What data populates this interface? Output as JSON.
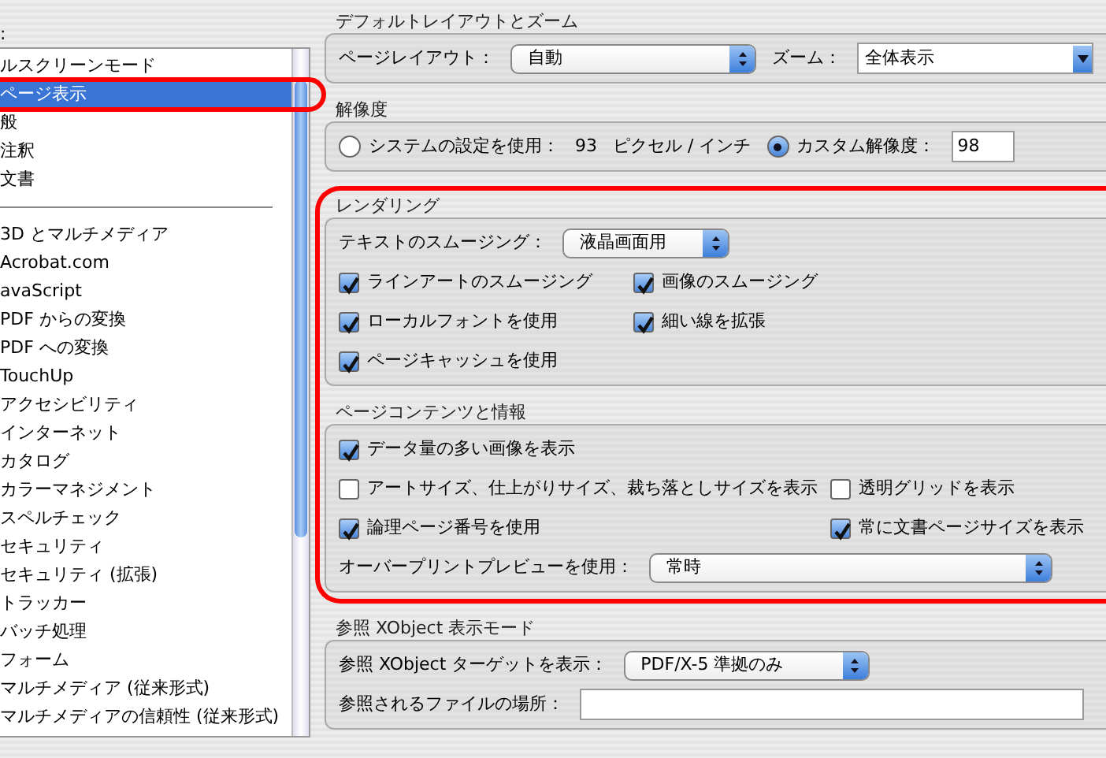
{
  "sidebar": {
    "label": ":",
    "groups": [
      [
        {
          "label": "ルスクリーンモード",
          "selected": false,
          "highlighted": false
        },
        {
          "label": "ページ表示",
          "selected": true,
          "highlighted": true
        },
        {
          "label": "般",
          "selected": false,
          "highlighted": false
        },
        {
          "label": "注釈",
          "selected": false,
          "highlighted": false
        },
        {
          "label": "文書",
          "selected": false,
          "highlighted": false
        }
      ],
      [
        {
          "label": "3D とマルチメディア",
          "selected": false,
          "highlighted": false
        },
        {
          "label": "Acrobat.com",
          "selected": false,
          "highlighted": false
        },
        {
          "label": "avaScript",
          "selected": false,
          "highlighted": false
        },
        {
          "label": "PDF からの変換",
          "selected": false,
          "highlighted": false
        },
        {
          "label": "PDF への変換",
          "selected": false,
          "highlighted": false
        },
        {
          "label": "TouchUp",
          "selected": false,
          "highlighted": false
        },
        {
          "label": "アクセシビリティ",
          "selected": false,
          "highlighted": false
        },
        {
          "label": "インターネット",
          "selected": false,
          "highlighted": false
        },
        {
          "label": "カタログ",
          "selected": false,
          "highlighted": false
        },
        {
          "label": "カラーマネジメント",
          "selected": false,
          "highlighted": false
        },
        {
          "label": "スペルチェック",
          "selected": false,
          "highlighted": false
        },
        {
          "label": "セキュリティ",
          "selected": false,
          "highlighted": false
        },
        {
          "label": "セキュリティ (拡張)",
          "selected": false,
          "highlighted": false
        },
        {
          "label": "トラッカー",
          "selected": false,
          "highlighted": false
        },
        {
          "label": "バッチ処理",
          "selected": false,
          "highlighted": false
        },
        {
          "label": "フォーム",
          "selected": false,
          "highlighted": false
        },
        {
          "label": "マルチメディア (従来形式)",
          "selected": false,
          "highlighted": false
        },
        {
          "label": "マルチメディアの信頼性 (従来形式)",
          "selected": false,
          "highlighted": false
        }
      ]
    ]
  },
  "sections": [
    {
      "kind": "plain",
      "title": "デフォルトレイアウトとズーム",
      "highlighted": false,
      "rows": [
        [
          {
            "kind": "label",
            "text": "ページレイアウト："
          },
          {
            "kind": "select",
            "value": "自動"
          },
          {
            "kind": "label",
            "text": "ズーム："
          },
          {
            "kind": "combo",
            "value": "全体表示"
          }
        ]
      ]
    },
    {
      "kind": "plain",
      "title": "解像度",
      "highlighted": false,
      "rows": [
        [
          {
            "kind": "radio",
            "label": "システムの設定を使用：",
            "selected": false
          },
          {
            "kind": "label",
            "text": "93"
          },
          {
            "kind": "label",
            "text": "ピクセル / インチ"
          },
          {
            "kind": "radio",
            "label": "カスタム解像度：",
            "selected": true
          },
          {
            "kind": "input",
            "value": "98"
          }
        ]
      ]
    },
    {
      "kind": "narrow",
      "title": "レンダリング",
      "highlighted": true,
      "rows": [
        [
          {
            "kind": "label",
            "text": "テキストのスムージング："
          },
          {
            "kind": "select",
            "value": "液晶画面用"
          }
        ],
        [
          {
            "kind": "checkbox",
            "label": "ラインアートのスムージング",
            "checked": true
          },
          {
            "kind": "checkbox",
            "label": "画像のスムージング",
            "checked": true
          }
        ],
        [
          {
            "kind": "checkbox",
            "label": "ローカルフォントを使用",
            "checked": true
          },
          {
            "kind": "checkbox",
            "label": "細い線を拡張",
            "checked": true
          }
        ],
        [
          {
            "kind": "checkbox",
            "label": "ページキャッシュを使用",
            "checked": true
          }
        ]
      ]
    },
    {
      "kind": "wide",
      "title": "ページコンテンツと情報",
      "highlighted": true,
      "rows": [
        [
          {
            "kind": "checkbox",
            "label": "データ量の多い画像を表示",
            "checked": true
          }
        ],
        [
          {
            "kind": "checkbox",
            "label": "アートサイズ、仕上がりサイズ、裁ち落としサイズを表示",
            "checked": false
          },
          {
            "kind": "checkbox",
            "label": "透明グリッドを表示",
            "checked": false
          }
        ],
        [
          {
            "kind": "checkbox",
            "label": "論理ページ番号を使用",
            "checked": true
          },
          {
            "kind": "checkbox",
            "label": "常に文書ページサイズを表示",
            "checked": true
          }
        ],
        [
          {
            "kind": "label",
            "text": "オーバープリントプレビューを使用："
          },
          {
            "kind": "select",
            "value": "常時"
          }
        ]
      ]
    },
    {
      "kind": "plain",
      "title": "参照 XObject 表示モード",
      "highlighted": false,
      "rows": [
        [
          {
            "kind": "label",
            "text": "参照 XObject ターゲットを表示："
          },
          {
            "kind": "select",
            "value": "PDF/X-5 準拠のみ"
          }
        ],
        [
          {
            "kind": "label",
            "text": "参照されるファイルの場所："
          },
          {
            "kind": "textbox"
          }
        ]
      ]
    }
  ]
}
